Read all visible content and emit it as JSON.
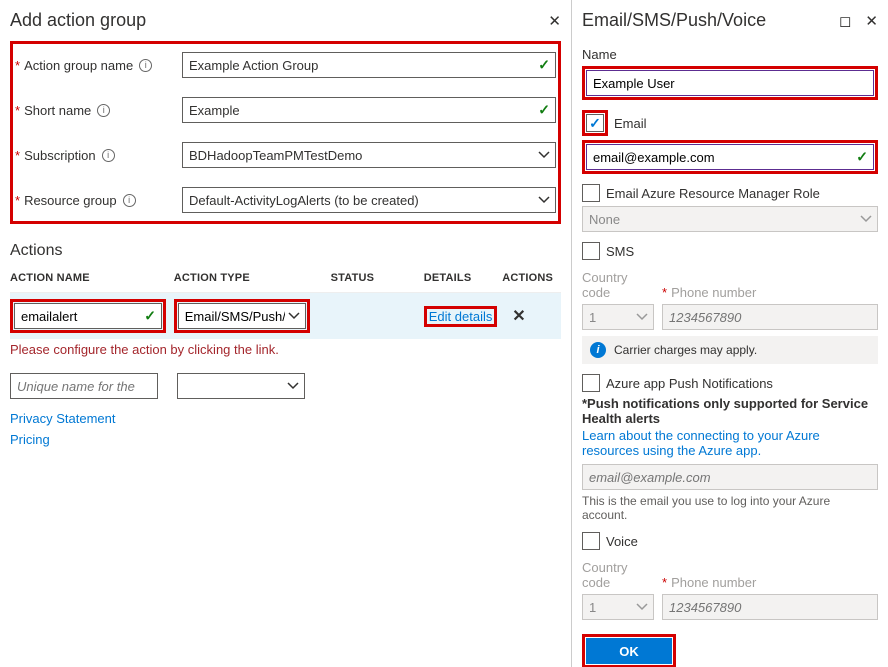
{
  "left": {
    "title": "Add action group",
    "labels": {
      "action_group_name": "Action group name",
      "short_name": "Short name",
      "subscription": "Subscription",
      "resource_group": "Resource group"
    },
    "values": {
      "action_group_name": "Example Action Group",
      "short_name": "Example",
      "subscription": "BDHadoopTeamPMTestDemo",
      "resource_group": "Default-ActivityLogAlerts (to be created)"
    },
    "actions": {
      "heading": "Actions",
      "cols": {
        "name": "Action Name",
        "type": "Action Type",
        "status": "Status",
        "details": "Details",
        "actions": "Actions"
      },
      "row1": {
        "name": "emailalert",
        "type": "Email/SMS/Push/V…",
        "edit": "Edit details"
      },
      "warning": "Please configure the action by clicking the link.",
      "placeholder": "Unique name for the act…"
    },
    "links": {
      "privacy": "Privacy Statement",
      "pricing": "Pricing"
    }
  },
  "right": {
    "title": "Email/SMS/Push/Voice",
    "name_label": "Name",
    "name_value": "Example User",
    "email_label": "Email",
    "email_value": "email@example.com",
    "arm_label": "Email Azure Resource Manager Role",
    "arm_value": "None",
    "sms_label": "SMS",
    "cc_label": "Country code",
    "phone_label": "Phone number",
    "cc_value": "1",
    "phone_placeholder": "1234567890",
    "carrier": "Carrier charges may apply.",
    "push_label": "Azure app Push Notifications",
    "push_note": "*Push notifications only supported for Service Health alerts",
    "push_link": "Learn about the connecting to your Azure resources using the Azure app.",
    "push_email_placeholder": "email@example.com",
    "push_sub": "This is the email you use to log into your Azure account.",
    "voice_label": "Voice",
    "ok": "OK"
  }
}
